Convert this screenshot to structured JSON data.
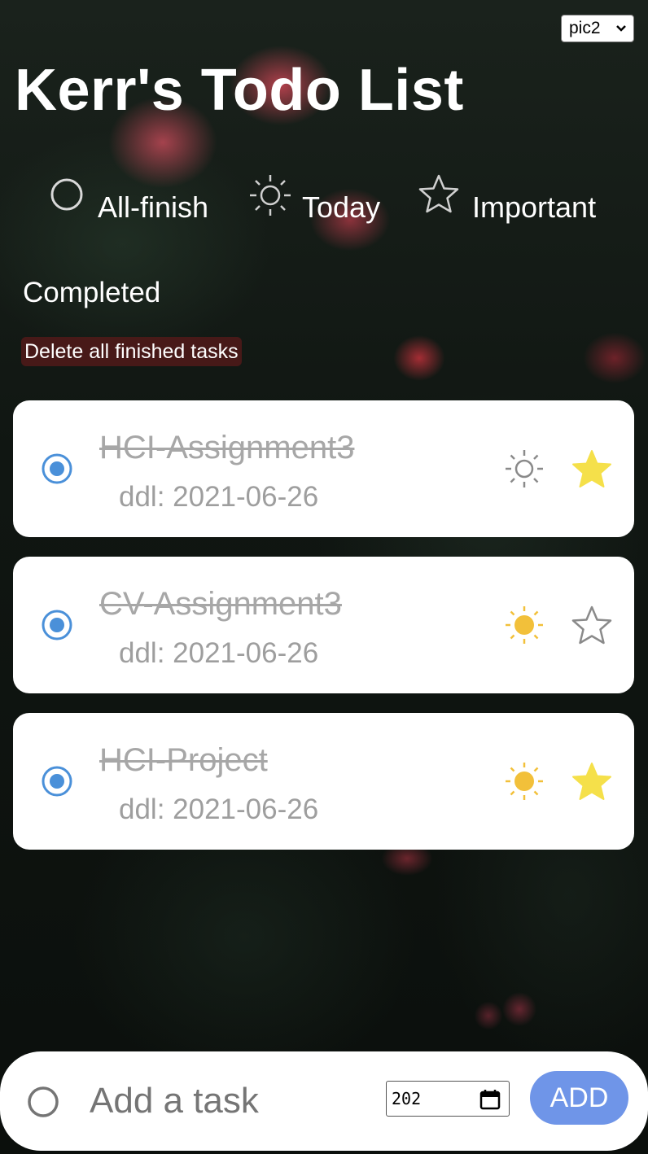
{
  "background_select": {
    "value": "pic2"
  },
  "app_title": "Kerr's Todo List",
  "filters": [
    {
      "label": "All-finish",
      "icon": "circle-icon"
    },
    {
      "label": "Today",
      "icon": "sun-icon"
    },
    {
      "label": "Important",
      "icon": "star-icon"
    }
  ],
  "section_title": "Completed",
  "delete_button_label": "Delete all finished tasks",
  "tasks": [
    {
      "name": "HCI-Assignment3",
      "ddl": "ddl: 2021-06-26",
      "completed": true,
      "today": false,
      "important": true
    },
    {
      "name": "CV-Assignment3",
      "ddl": "ddl: 2021-06-26",
      "completed": true,
      "today": true,
      "important": false
    },
    {
      "name": "HCI-Project",
      "ddl": "ddl: 2021-06-26",
      "completed": true,
      "today": true,
      "important": true
    }
  ],
  "add_bar": {
    "placeholder": "Add a task",
    "date_value": "202",
    "add_label": "ADD"
  },
  "colors": {
    "check_blue": "#4a90d9",
    "sun_active": "#f2c03a",
    "star_active": "#f5e04a",
    "add_button": "#6f95e8",
    "delete_button": "#5a1919"
  }
}
